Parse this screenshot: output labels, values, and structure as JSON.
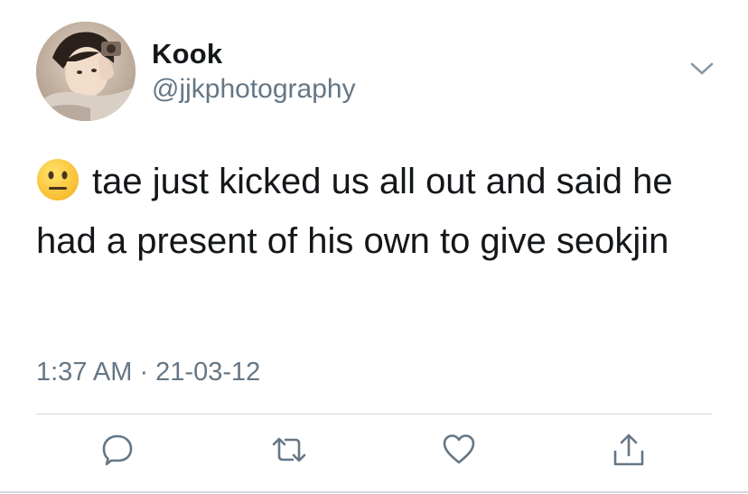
{
  "user": {
    "display_name": "Kook",
    "handle": "@jjkphotography",
    "avatar": "profile-photo"
  },
  "tweet": {
    "emoji": "neutral-face-emoji",
    "text": "tae just kicked us all out and said he had a present of his own to give seokjin",
    "timestamp": "1:37 AM · 21-03-12"
  },
  "actions": [
    {
      "name": "reply",
      "icon": "speech-bubble-icon"
    },
    {
      "name": "retweet",
      "icon": "retweet-arrows-icon"
    },
    {
      "name": "like",
      "icon": "heart-icon"
    },
    {
      "name": "share",
      "icon": "share-upload-icon"
    }
  ],
  "colors": {
    "text_primary": "#14171a",
    "text_secondary": "#657786",
    "divider": "#ccd6dd",
    "icon": "#657786"
  }
}
